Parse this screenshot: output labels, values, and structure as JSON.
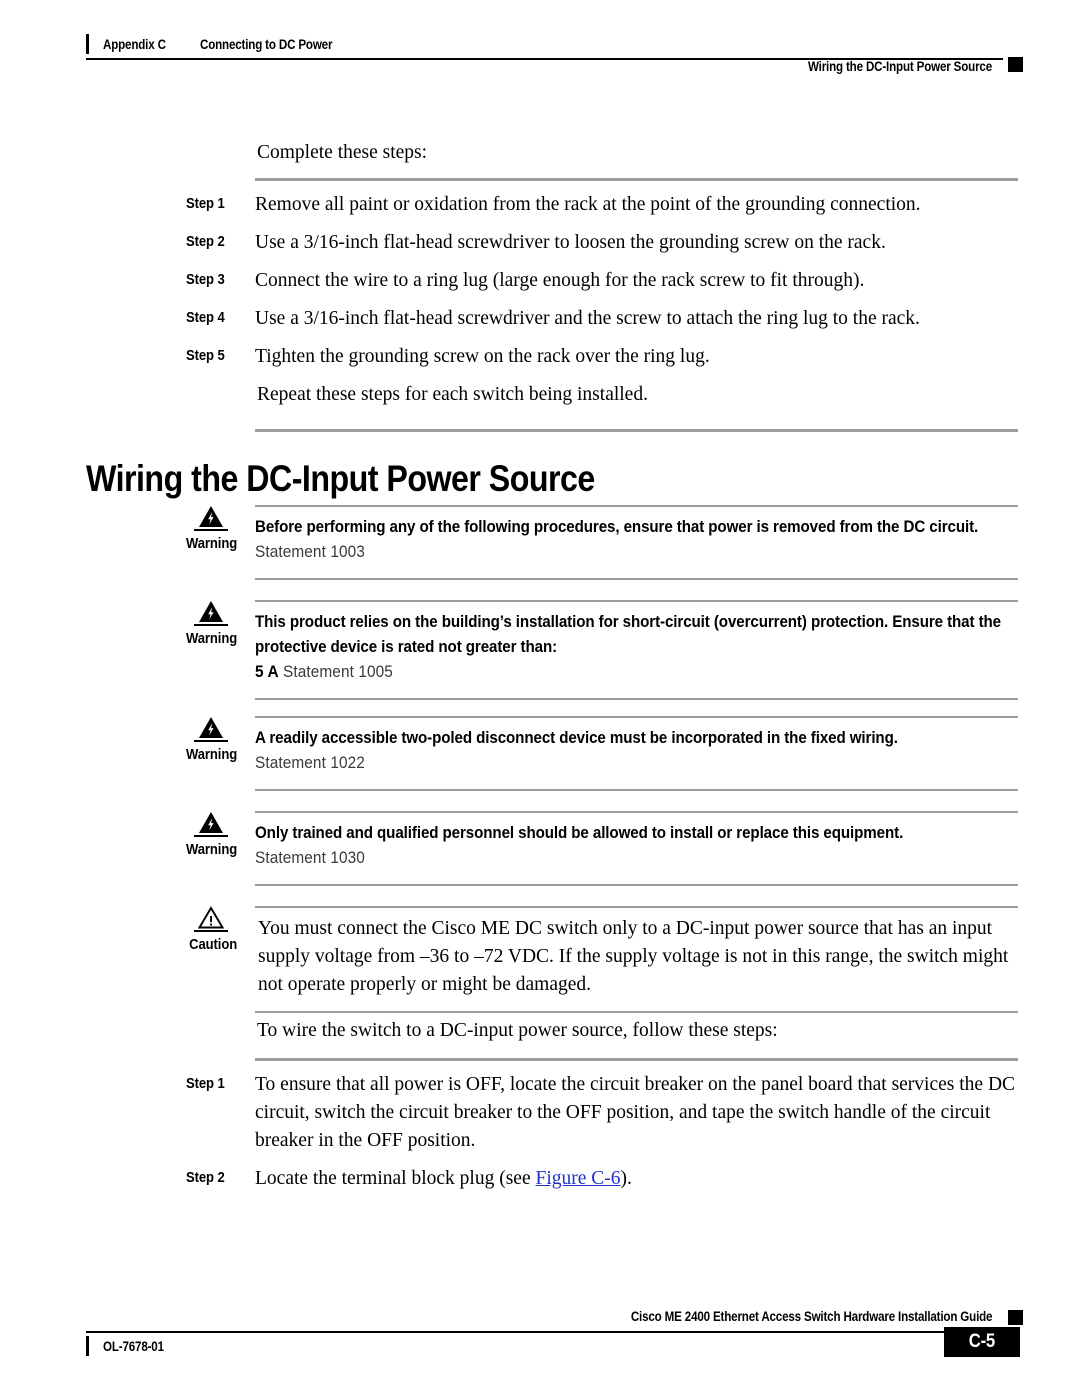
{
  "header": {
    "appendix": "Appendix C",
    "chapter_title": "Connecting to DC Power",
    "section_title": "Wiring the DC-Input Power Source"
  },
  "intro": {
    "text": "Complete these steps:"
  },
  "steps_ground": {
    "items": [
      {
        "label": "Step 1",
        "text": "Remove all paint or oxidation from the rack at the point of the grounding connection."
      },
      {
        "label": "Step 2",
        "text": "Use a 3/16-inch flat-head screwdriver to loosen the grounding screw on the rack."
      },
      {
        "label": "Step 3",
        "text": "Connect the wire to a ring lug (large enough for the rack screw to fit through)."
      },
      {
        "label": "Step 4",
        "text": "Use a 3/16-inch flat-head screwdriver and the screw to attach the ring lug to the rack."
      },
      {
        "label": "Step 5",
        "text": "Tighten the grounding screw on the rack over the ring lug."
      }
    ],
    "closing": "Repeat these steps for each switch being installed."
  },
  "heading": {
    "title": "Wiring the DC-Input Power Source"
  },
  "admonitions": [
    {
      "kind": "warning",
      "icon": "warning-lightning-triangle-icon",
      "label": "Warning",
      "body": "Before performing any of the following procedures, ensure that power is removed from the DC circuit.",
      "statement": "Statement 1003"
    },
    {
      "kind": "warning",
      "icon": "warning-lightning-triangle-icon",
      "label": "Warning",
      "body": "This product relies on the building’s installation for short-circuit (overcurrent) protection. Ensure that the protective device is rated not greater than:",
      "rating": "5 A",
      "statement": "Statement 1005"
    },
    {
      "kind": "warning",
      "icon": "warning-lightning-triangle-icon",
      "label": "Warning",
      "body": "A readily accessible two-poled disconnect device must be incorporated in the fixed wiring.",
      "statement": "Statement 1022"
    },
    {
      "kind": "warning",
      "icon": "warning-lightning-triangle-icon",
      "label": "Warning",
      "body": "Only trained and qualified personnel should be allowed to install or replace this equipment.",
      "statement": "Statement 1030"
    },
    {
      "kind": "caution",
      "icon": "caution-exclamation-triangle-icon",
      "label": "Caution",
      "body": "You must connect the Cisco ME DC switch only to a DC-input power source that has an input supply voltage from –36 to –72 VDC. If the supply voltage is not in this range, the switch might not operate properly or might be damaged."
    }
  ],
  "wire_intro": {
    "text": "To wire the switch to a DC-input power source, follow these steps:"
  },
  "steps_wire": {
    "items": [
      {
        "label": "Step 1",
        "text": "To ensure that all power is OFF, locate the circuit breaker on the panel board that services the DC circuit, switch the circuit breaker to the OFF position, and tape the switch handle of the circuit breaker in the OFF position."
      },
      {
        "label": "Step 2",
        "text_before": "Locate the terminal block plug (see ",
        "link_text": "Figure C-6",
        "text_after": ")."
      }
    ]
  },
  "footer": {
    "guide_title": "Cisco ME 2400 Ethernet Access Switch Hardware Installation Guide",
    "doc_id": "OL-7678-01",
    "page_number": "C-5"
  },
  "colors": {
    "link": "#1f31c6",
    "rule_gray": "#9d9d9d",
    "ink": "#000000"
  }
}
